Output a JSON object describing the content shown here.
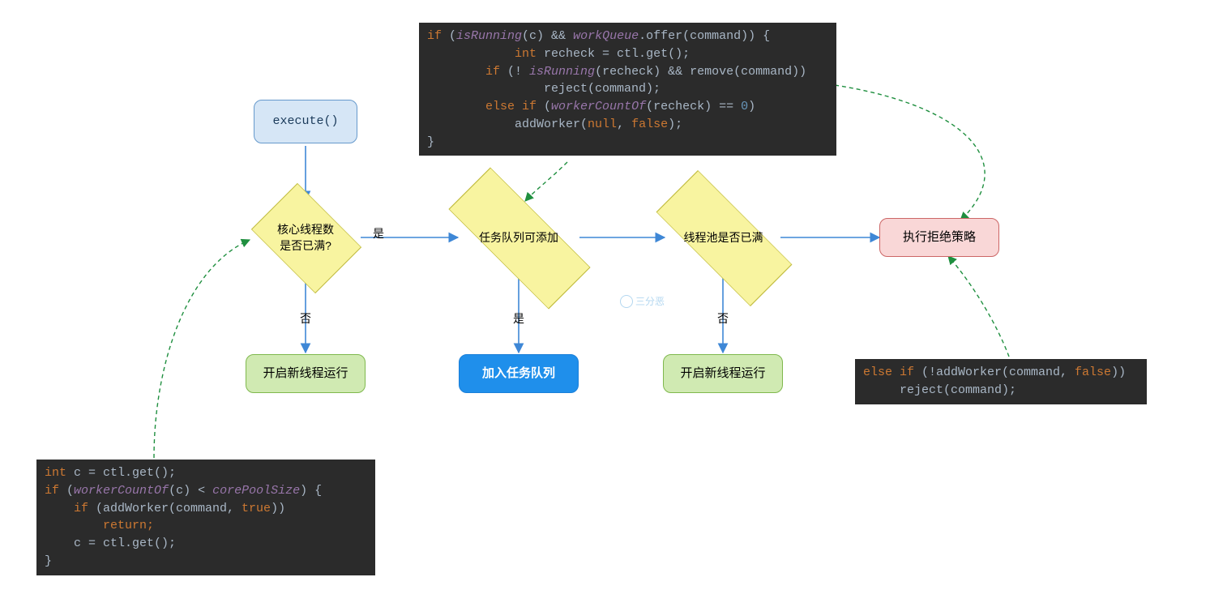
{
  "nodes": {
    "execute": {
      "label": "execute()"
    },
    "d1": {
      "label": "核心线程数\n是否已满?"
    },
    "d2": {
      "label": "任务队列可添加"
    },
    "d3": {
      "label": "线程池是否已满"
    },
    "reject": {
      "label": "执行拒绝策略"
    },
    "g1": {
      "label": "开启新线程运行"
    },
    "b1": {
      "label": "加入任务队列"
    },
    "g2": {
      "label": "开启新线程运行"
    }
  },
  "edgeLabels": {
    "d1_right": "是",
    "d1_down": "否",
    "d2_down": "是",
    "d3_down": "否"
  },
  "watermark": "三分恶",
  "code": {
    "bottomLeft": {
      "lines": [
        [
          {
            "t": "int ",
            "c": "kw"
          },
          {
            "t": "c = ctl.",
            "c": "var"
          },
          {
            "t": "get",
            "c": "var"
          },
          {
            "t": "();",
            "c": "punc"
          }
        ],
        [
          {
            "t": "if ",
            "c": "kw"
          },
          {
            "t": "(",
            "c": "punc"
          },
          {
            "t": "workerCountOf",
            "c": "fn"
          },
          {
            "t": "(c) < ",
            "c": "punc"
          },
          {
            "t": "corePoolSize",
            "c": "fn"
          },
          {
            "t": ") {",
            "c": "punc"
          }
        ],
        [
          {
            "t": "    if ",
            "c": "kw"
          },
          {
            "t": "(addWorker(command, ",
            "c": "var"
          },
          {
            "t": "true",
            "c": "bool"
          },
          {
            "t": "))",
            "c": "punc"
          }
        ],
        [
          {
            "t": "        return;",
            "c": "kw"
          }
        ],
        [
          {
            "t": "    c = ctl.",
            "c": "var"
          },
          {
            "t": "get",
            "c": "var"
          },
          {
            "t": "();",
            "c": "punc"
          }
        ],
        [
          {
            "t": "}",
            "c": "punc"
          }
        ]
      ]
    },
    "top": {
      "lines": [
        [
          {
            "t": "if ",
            "c": "kw"
          },
          {
            "t": "(",
            "c": "punc"
          },
          {
            "t": "isRunning",
            "c": "fn"
          },
          {
            "t": "(c) && ",
            "c": "punc"
          },
          {
            "t": "workQueue",
            "c": "fn"
          },
          {
            "t": ".offer(command)) {",
            "c": "var"
          }
        ],
        [
          {
            "t": "            int ",
            "c": "kw"
          },
          {
            "t": "recheck = ctl.",
            "c": "var"
          },
          {
            "t": "get",
            "c": "var"
          },
          {
            "t": "();",
            "c": "punc"
          }
        ],
        [
          {
            "t": "        if ",
            "c": "kw"
          },
          {
            "t": "(! ",
            "c": "punc"
          },
          {
            "t": "isRunning",
            "c": "fn"
          },
          {
            "t": "(recheck) && remove(command))",
            "c": "var"
          }
        ],
        [
          {
            "t": "                reject(command);",
            "c": "var"
          }
        ],
        [
          {
            "t": "        else if ",
            "c": "kw"
          },
          {
            "t": "(",
            "c": "punc"
          },
          {
            "t": "workerCountOf",
            "c": "fn"
          },
          {
            "t": "(recheck) == ",
            "c": "var"
          },
          {
            "t": "0",
            "c": "num"
          },
          {
            "t": ")",
            "c": "punc"
          }
        ],
        [
          {
            "t": "            addWorker(",
            "c": "var"
          },
          {
            "t": "null",
            "c": "bool"
          },
          {
            "t": ", ",
            "c": "var"
          },
          {
            "t": "false",
            "c": "bool"
          },
          {
            "t": ");",
            "c": "var"
          }
        ],
        [
          {
            "t": "}",
            "c": "punc"
          }
        ]
      ]
    },
    "right": {
      "lines": [
        [
          {
            "t": "else if ",
            "c": "kw"
          },
          {
            "t": "(!addWorker(command, ",
            "c": "var"
          },
          {
            "t": "false",
            "c": "bool"
          },
          {
            "t": "))",
            "c": "punc"
          }
        ],
        [
          {
            "t": "     reject(command);",
            "c": "var"
          }
        ]
      ]
    }
  }
}
